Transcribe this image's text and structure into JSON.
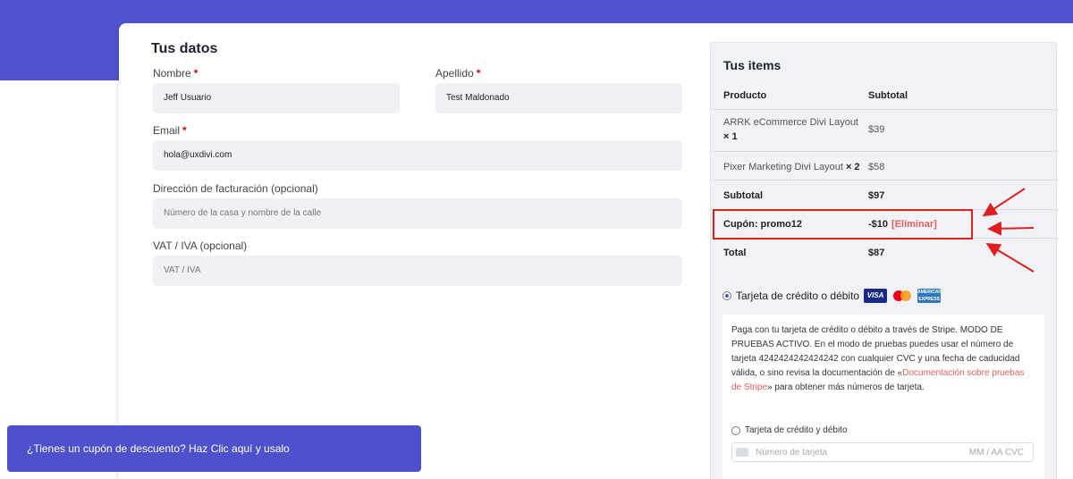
{
  "colors": {
    "brand": "#5053d0",
    "banner": "#4d51cc",
    "required": "#d40000",
    "highlight": "#e02020",
    "link": "#e06060"
  },
  "form": {
    "title": "Tus datos",
    "first_name": {
      "label": "Nombre",
      "required_mark": "*",
      "value": "Jeff Usuario"
    },
    "last_name": {
      "label": "Apellido",
      "required_mark": "*",
      "value": "Test Maldonado"
    },
    "email": {
      "label": "Email",
      "required_mark": "*",
      "value": "hola@uxdivi.com"
    },
    "address": {
      "label": "Dirección de facturación (opcional)",
      "placeholder": "Número de la casa y nombre de la calle"
    },
    "vat": {
      "label": "VAT / IVA (opcional)",
      "placeholder": "VAT / IVA"
    }
  },
  "summary": {
    "title": "Tus items",
    "col_product": "Producto",
    "col_subtotal": "Subtotal",
    "items": [
      {
        "name": "ARRK eCommerce Divi Layout",
        "qty": "× 1",
        "price": "$39"
      },
      {
        "name": "Pixer Marketing Divi Layout",
        "qty": "× 2",
        "price": "$58"
      }
    ],
    "subtotal_label": "Subtotal",
    "subtotal_value": "$97",
    "coupon_label": "Cupón: promo12",
    "coupon_value": "-$10",
    "coupon_remove": "[Eliminar]",
    "total_label": "Total",
    "total_value": "$87"
  },
  "payment": {
    "method_label": "Tarjeta de crédito o débito",
    "card_brands": [
      "visa-logo",
      "mastercard-logo",
      "amex-logo"
    ],
    "visa_text": "VISA",
    "amex_text": "AMERICAN EXPRESS",
    "desc_before_link": "Paga con tu tarjeta de crédito o débito a través de Stripe. MODO DE PRUEBAS ACTIVO. En el modo de pruebas puedes usar el número de tarjeta 4242424242424242 con cualquier CVC y una fecha de caducidad válida, o sino revisa la documentación de «",
    "desc_link": "Documentación sobre pruebas de Stripe",
    "desc_after_link": "» para obtener más números de tarjeta.",
    "sub_option": "Tarjeta de crédito y débito",
    "card_number_placeholder": "Número de tarjeta",
    "card_exp_placeholder": "MM / AA  CVC"
  },
  "coupon_banner": {
    "text": "¿Tienes un cupón de descuento? Haz Clic aquí y usalo"
  }
}
